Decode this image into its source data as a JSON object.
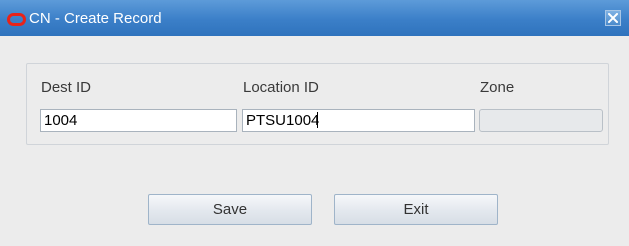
{
  "window": {
    "title": "CN - Create Record",
    "logo_color": "#e8231a"
  },
  "form": {
    "dest_id": {
      "label": "Dest ID",
      "value": "1004"
    },
    "location_id": {
      "label": "Location ID",
      "value": "PTSU1004"
    },
    "zone": {
      "label": "Zone",
      "value": ""
    }
  },
  "buttons": {
    "save_label": "Save",
    "exit_label": "Exit"
  }
}
